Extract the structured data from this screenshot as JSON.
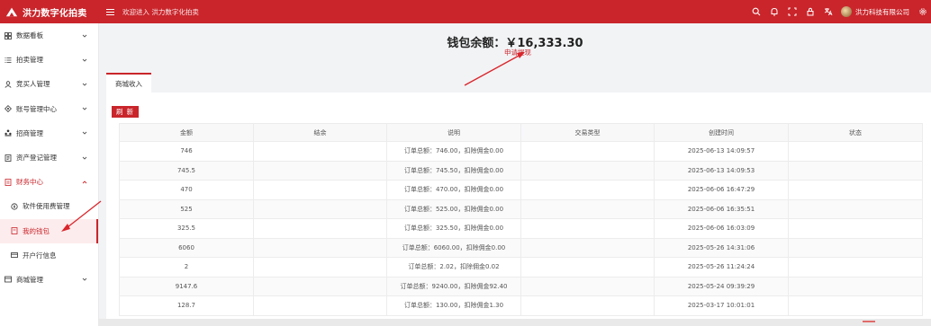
{
  "app": {
    "title": "洪力数字化拍卖",
    "welcome": "欢迎进入 洪力数字化拍卖"
  },
  "header": {
    "user_name": "洪力科技有限公司",
    "icons": [
      "search-icon",
      "bell-icon",
      "fullscreen-icon",
      "lock-icon",
      "language-icon",
      "avatar",
      "settings-icon"
    ]
  },
  "sidebar": {
    "items": [
      {
        "label": "数据看板",
        "icon": "grid-icon"
      },
      {
        "label": "拍卖管理",
        "icon": "list-icon"
      },
      {
        "label": "竞买人管理",
        "icon": "user-icon"
      },
      {
        "label": "账号管理中心",
        "icon": "diamond-icon"
      },
      {
        "label": "招商管理",
        "icon": "people-icon"
      },
      {
        "label": "资产登记管理",
        "icon": "document-icon"
      },
      {
        "label": "财务中心",
        "icon": "finance-icon"
      },
      {
        "label": "软件使用费管理",
        "icon": "coin-icon"
      },
      {
        "label": "我的钱包",
        "icon": "wallet-icon"
      },
      {
        "label": "开户行信息",
        "icon": "card-icon"
      },
      {
        "label": "商城管理",
        "icon": "shop-icon"
      }
    ]
  },
  "wallet": {
    "balance_label": "钱包余额：￥16,333.30",
    "withdraw_label": "申请提现"
  },
  "tabs": [
    {
      "label": "商城收入"
    }
  ],
  "toolbar": {
    "refresh_label": "刷 新"
  },
  "table": {
    "columns": [
      "金额",
      "结余",
      "说明",
      "交易类型",
      "创建时间",
      "状态"
    ],
    "rows": [
      [
        "746",
        "",
        "订单总额：746.00，扣除佣金0.00",
        "",
        "2025-06-13 14:09:57",
        ""
      ],
      [
        "745.5",
        "",
        "订单总额：745.50，扣除佣金0.00",
        "",
        "2025-06-13 14:09:53",
        ""
      ],
      [
        "470",
        "",
        "订单总额：470.00，扣除佣金0.00",
        "",
        "2025-06-06 16:47:29",
        ""
      ],
      [
        "525",
        "",
        "订单总额：525.00，扣除佣金0.00",
        "",
        "2025-06-06 16:35:51",
        ""
      ],
      [
        "325.5",
        "",
        "订单总额：325.50，扣除佣金0.00",
        "",
        "2025-06-06 16:03:09",
        ""
      ],
      [
        "6060",
        "",
        "订单总额：6060.00，扣除佣金0.00",
        "",
        "2025-05-26 14:31:06",
        ""
      ],
      [
        "2",
        "",
        "订单总额：2.02，扣除佣金0.02",
        "",
        "2025-05-26 11:24:24",
        ""
      ],
      [
        "9147.6",
        "",
        "订单总额：9240.00，扣除佣金92.40",
        "",
        "2025-05-24 09:39:29",
        ""
      ],
      [
        "128.7",
        "",
        "订单总额：130.00，扣除佣金1.30",
        "",
        "2025-03-17 10:01:01",
        ""
      ]
    ]
  },
  "colors": {
    "brand": "#c9252b",
    "active_bg": "#fdeced"
  }
}
